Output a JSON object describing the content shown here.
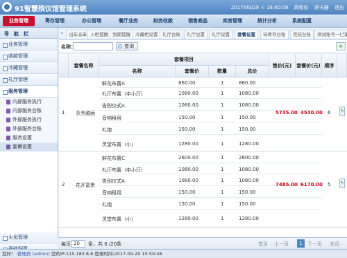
{
  "header": {
    "title": "91智慧殡仪馆管理系统",
    "datetime": "2017/09/29 ☉ 16:00:08",
    "user": "高松仪",
    "logout": "退卡器",
    "exit": "退出"
  },
  "menu": [
    "业务管理",
    "寄存管理",
    "办公管理",
    "餐厅业务",
    "财务收款",
    "销售商品",
    "库房管理",
    "统计分析",
    "系统配置"
  ],
  "sidebar": {
    "head": [
      "导",
      "航",
      "栏"
    ],
    "groups_top": [
      "业务管理",
      "收款管理",
      "冷藏管理",
      "礼厅管理",
      "服务管理"
    ],
    "service_items": [
      "内部服务执行",
      "内部服务台账",
      "外部服务执行",
      "外部服务台账",
      "服务设置",
      "套餐设置"
    ],
    "groups_bottom": [
      "火化管理",
      "基础配置"
    ]
  },
  "tabs": [
    "出车派单",
    "入柜提醒",
    "到期提醒",
    "冷藏柜设置",
    "礼厅台账",
    "礼厅设置",
    "礼厅设置",
    "套餐设置",
    "待寄存台账",
    "完结台账",
    "测试账号一档案"
  ],
  "active_tab_index": 7,
  "search": {
    "label": "名称：",
    "button": "查询",
    "add": "+"
  },
  "table": {
    "col_setname": "套餐名称",
    "col_items": "套餐项目",
    "col_name": "名称",
    "col_unit": "套餐价",
    "col_qty": "数量",
    "col_total": "总价",
    "col_sale": "售价(元)",
    "col_pkgprice": "套餐价(元)",
    "col_order": "顺序",
    "rows": [
      {
        "no": "1",
        "name": "芬芳雅丽",
        "sale": "5735.00",
        "pkg": "4530.00",
        "order": "6",
        "items": [
          {
            "n": "鲜花布置A",
            "p": "860.00",
            "q": "1",
            "t": "860.00"
          },
          {
            "n": "礼厅布置（中小厅）",
            "p": "1080.00",
            "q": "1",
            "t": "1080.00"
          },
          {
            "n": "告别仪式A",
            "p": "1080.00",
            "q": "1",
            "t": "1080.00"
          },
          {
            "n": "音响租用",
            "p": "150.00",
            "q": "1",
            "t": "150.00"
          },
          {
            "n": "礼炮",
            "p": "150.00",
            "q": "1",
            "t": "150.00"
          },
          {
            "n": "灵堂布置（小）",
            "p": "1280.00",
            "q": "1",
            "t": "1280.00"
          }
        ]
      },
      {
        "no": "2",
        "name": "花开富贵",
        "sale": "7485.00",
        "pkg": "6170.00",
        "order": "5",
        "items": [
          {
            "n": "鲜花布置C",
            "p": "2600.00",
            "q": "1",
            "t": "2600.00"
          },
          {
            "n": "礼厅布置（中小厅）",
            "p": "1080.00",
            "q": "1",
            "t": "1080.00"
          },
          {
            "n": "告别仪式A",
            "p": "1080.00",
            "q": "1",
            "t": "1080.00"
          },
          {
            "n": "音响租用",
            "p": "150.00",
            "q": "1",
            "t": "150.00"
          },
          {
            "n": "礼炮",
            "p": "150.00",
            "q": "1",
            "t": "150.00"
          },
          {
            "n": "灵堂布置（小）",
            "p": "1280.00",
            "q": "1",
            "t": "1280.00"
          }
        ]
      }
    ]
  },
  "pager": {
    "per_page_label": "每页",
    "per_page": "20",
    "summary": "条，共 6 /20条",
    "first": "首页",
    "prev": "上一页",
    "page": "1",
    "next": "下一页",
    "last": "末页"
  },
  "status": {
    "prefix": "您好！-",
    "user": "管理员 (admin)",
    "rest": "您的IP:115.183.8.6 登录时间:2017-09-29 15:50:48"
  }
}
